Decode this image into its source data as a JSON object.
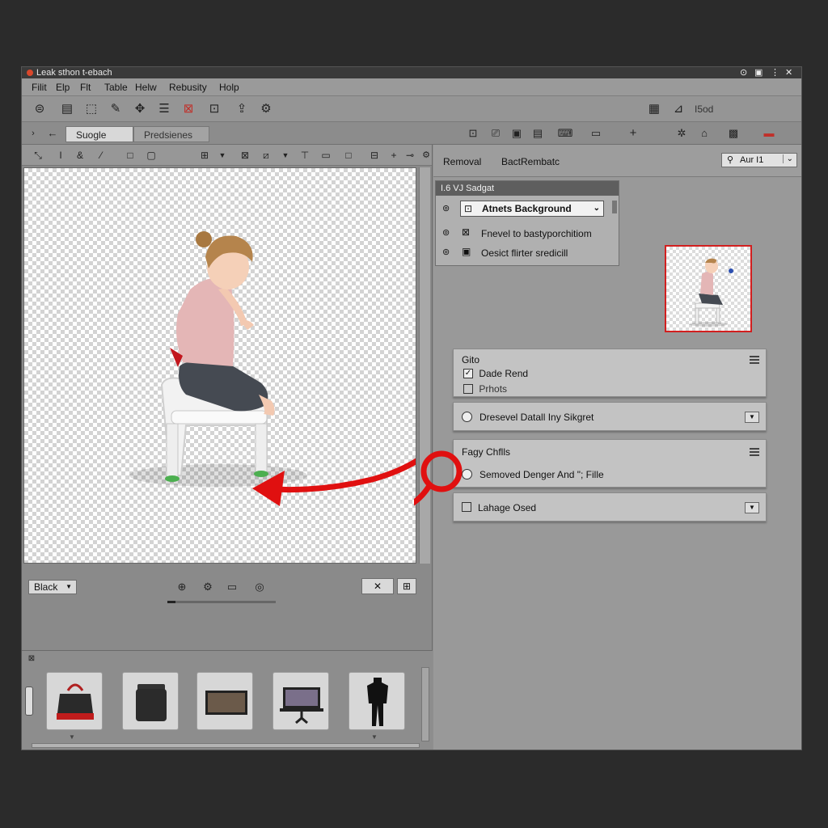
{
  "window": {
    "title": "Leak sthon t-ebach",
    "controls": [
      "⊙",
      "▣",
      "⋮",
      "✕"
    ]
  },
  "menu": [
    "Filit",
    "Elp",
    "Flt",
    "Table",
    "Helw",
    "Rebusity",
    "Holp"
  ],
  "toolbar": {
    "icons": [
      "co-icon",
      "panel-icon",
      "eraser-icon",
      "pen-icon",
      "move-icon",
      "layers-icon",
      "image-icon",
      "crop-icon",
      "export-icon",
      "settings-icon"
    ],
    "right_text": "I5od"
  },
  "tabs": {
    "active": "Suogle",
    "inactive": "Predsienes"
  },
  "canvas_footer": {
    "dropdown": "Black",
    "zoom_controls": [
      "⊕",
      "⚙",
      "▭",
      "◎"
    ]
  },
  "right": {
    "tab1": "Removal",
    "tab2": "BactRembatc",
    "search": "Aur I1",
    "float_panel": {
      "title": "I.6 VJ Sadgat",
      "rows": [
        "Atnets Background",
        "Fnevel to bastyporchitiom",
        "Oesict flirter sredicill"
      ]
    },
    "card1": {
      "title": "Gito",
      "check1": "Dade Rend",
      "check2": "Prhots"
    },
    "card2": {
      "label": "Dresevel Datall Iny Sikgret"
    },
    "card3": {
      "title": "Fagy Chflls",
      "label": "Semoved Denger And \"; Fille"
    },
    "card4": {
      "label": "Lahage Osed"
    }
  },
  "colors": {
    "accent_red": "#e01010",
    "window_bg": "#8f8f8f",
    "card_bg": "#c3c3c3"
  }
}
